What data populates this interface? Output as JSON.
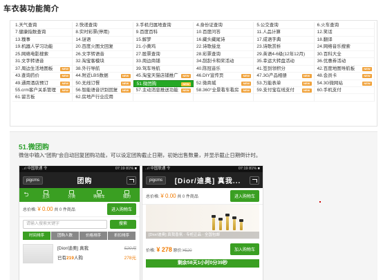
{
  "page": {
    "title": "车衣装功能简介"
  },
  "features": [
    "1.天气查询",
    "2.快递查询",
    "3.手机归属地查询",
    "4.身份证查询",
    "5.公交查询",
    "6.火车查询",
    "7.健康指数查询",
    "8.实时彩票(停用)",
    "9.百度百科",
    "10.百度问答",
    "11.人品计算",
    "12.笑话",
    "13.糗事",
    "14.谜语",
    "15.解梦",
    "16.藏头藏尾诗",
    "17.成语字典",
    "18.翻译",
    "19.机器人学习功能",
    "20.百度火图文回复",
    "21.小黄鸡",
    "22.诗歌接龙",
    "23.诗歌赏析",
    "24.网络音乐搜索",
    "25.网络电影搜索",
    "26.文字转语音",
    "27.股票查询",
    "28.彩票查询",
    "29.英语4-6级(12年12月)",
    "30.百科大全",
    "31.文字转语音",
    "32.淘宝客模块",
    "33.周边商铺",
    "34.刮刮卡和奖活动",
    "35.幸运大转盘活动",
    "36.优惠券活动",
    "37.周边生活地图板",
    "38.外行导航",
    "39.驾车导航",
    "40.陈冠音乐",
    "41.签到领积分",
    "42.百度地图导航板",
    "43.查询药价",
    "44.附近LBS数据",
    "45.淘宝天猫店铺推广",
    "46.DIY宣传页",
    "47.3G产品相册",
    "48.会员卡",
    "49.通用酒店预订",
    "50.无线订餐",
    "51.微团购",
    "52.微商城",
    "53.万能表单",
    "54.3G微网站",
    "55.crm客户关系管理",
    "56.智能语音识别回复",
    "57.主动消息推送功能",
    "58.360°全景看车看房",
    "59.支付宝在线支付",
    "60.手机支付",
    "61.留言板",
    "62.房地产行业应用",
    "",
    "",
    "",
    ""
  ],
  "feature_new_flags": [
    false,
    false,
    false,
    false,
    false,
    false,
    false,
    false,
    false,
    false,
    false,
    false,
    false,
    false,
    false,
    false,
    false,
    false,
    false,
    false,
    false,
    false,
    false,
    false,
    false,
    false,
    false,
    false,
    false,
    false,
    false,
    false,
    false,
    false,
    false,
    false,
    true,
    false,
    false,
    false,
    false,
    true,
    true,
    true,
    true,
    true,
    true,
    true,
    true,
    true,
    true,
    true,
    true,
    true,
    true,
    true,
    true,
    true,
    true,
    false,
    false,
    false,
    false,
    false,
    false,
    false
  ],
  "active_feature_index": 50,
  "panel": {
    "title": "51.微团购",
    "description": "微信中输入\"团购\"会自动回复团购功能，可以设定团购截止日期，初始出售数量，并显示截止日期倒计时。"
  },
  "phone1": {
    "status_left": "..ıl 中国联通 令",
    "status_right": "07:19  81% ■",
    "brand": "pigcms",
    "title": "团购",
    "nav": [
      "主页",
      "分类",
      "购物车",
      "我的"
    ],
    "total_label": "总价格:",
    "total_value": "¥ 0.00",
    "total_unit": "共 0 件商品",
    "cart_button": "进入购物车",
    "search_placeholder": "请输入搜索关键字",
    "search_button": "搜索",
    "sort_tabs": [
      "时间排序",
      "团购人数",
      "价格排序",
      "折扣排序"
    ],
    "product_name": "[Dior/迪奥] 真我",
    "product_old_price": "520元",
    "product_sold_prefix": "已有",
    "product_sold_count": "219",
    "product_sold_suffix": "人购",
    "product_price": "278元"
  },
  "phone2": {
    "status_left": "..ıl 中国联通 令",
    "status_right": "07:19  81% ■",
    "brand": "pigcms",
    "title": "[Dior/迪奥] 真我...",
    "total_label": "总价格:",
    "total_value": "¥ 0.00",
    "total_unit": "共 0 件商品",
    "cart_button": "进入购物车",
    "banner_caption": "[Dior/迪奥] 真我香氛 · 专柜正品 · 全国包邮",
    "price_label": "价格:",
    "price_value": "¥ 278",
    "old_price_label": "原价:",
    "old_price_value": "¥520",
    "cart_button2": "加入购物车",
    "countdown": "剩余58天1小时0分39秒"
  },
  "colors": {
    "accent_green": "#3a9f22",
    "active_cell": "#25a825",
    "price_orange": "#f07a00",
    "new_badge": "#f0a23b"
  }
}
